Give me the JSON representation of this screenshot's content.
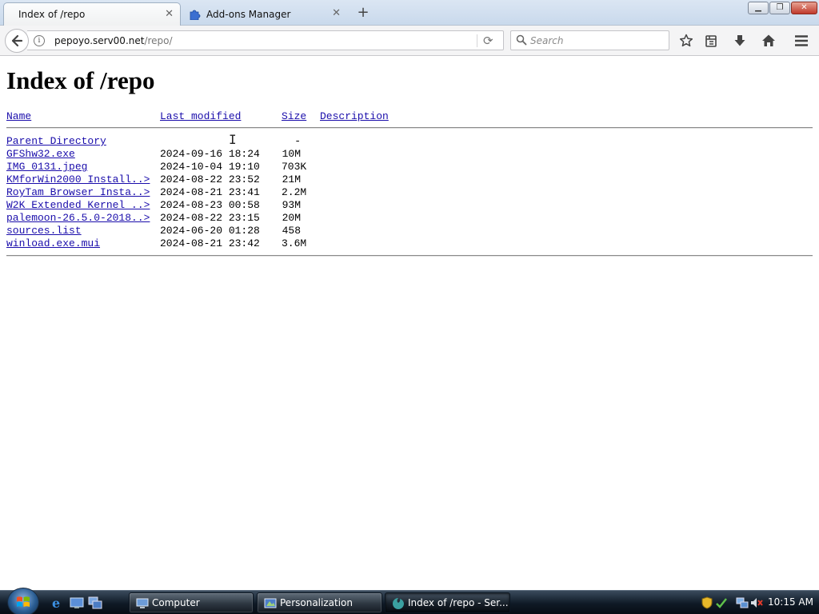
{
  "browser": {
    "tabs": [
      {
        "label": "Index of /repo",
        "active": true
      },
      {
        "label": "Add-ons Manager",
        "active": false
      }
    ],
    "url": {
      "host": "pepoyo.serv00.net",
      "path": "/repo/"
    },
    "search": {
      "placeholder": "Search"
    },
    "icons": [
      "back-arrow-icon",
      "info-icon",
      "reload-icon",
      "search-icon",
      "bookmark-star-icon",
      "library-icon",
      "download-icon",
      "home-icon",
      "menu-icon"
    ]
  },
  "page": {
    "title": "Index of /repo",
    "columns": {
      "name": "Name",
      "modified": "Last modified",
      "size": "Size",
      "description": "Description"
    },
    "rows": [
      {
        "name": "Parent Directory",
        "modified": "",
        "size": "-"
      },
      {
        "name": "GFShw32.exe",
        "modified": "2024-09-16 18:24",
        "size": "10M"
      },
      {
        "name": "IMG 0131.jpeg",
        "modified": "2024-10-04 19:10",
        "size": "703K"
      },
      {
        "name": "KMforWin2000 Install..>",
        "modified": "2024-08-22 23:52",
        "size": "21M"
      },
      {
        "name": "RoyTam Browser Insta..>",
        "modified": "2024-08-21 23:41",
        "size": "2.2M"
      },
      {
        "name": "W2K Extended Kernel ..>",
        "modified": "2024-08-23 00:58",
        "size": "93M"
      },
      {
        "name": "palemoon-26.5.0-2018..>",
        "modified": "2024-08-22 23:15",
        "size": "20M"
      },
      {
        "name": "sources.list",
        "modified": "2024-06-20 01:28",
        "size": "458"
      },
      {
        "name": "winload.exe.mui",
        "modified": "2024-08-21 23:42",
        "size": "3.6M"
      }
    ],
    "link_color": "#1a0dab"
  },
  "taskbar": {
    "tasks": [
      {
        "label": "Computer"
      },
      {
        "label": "Personalization"
      },
      {
        "label": "Index of /repo - Ser..."
      }
    ],
    "clock": "10:15 AM"
  }
}
